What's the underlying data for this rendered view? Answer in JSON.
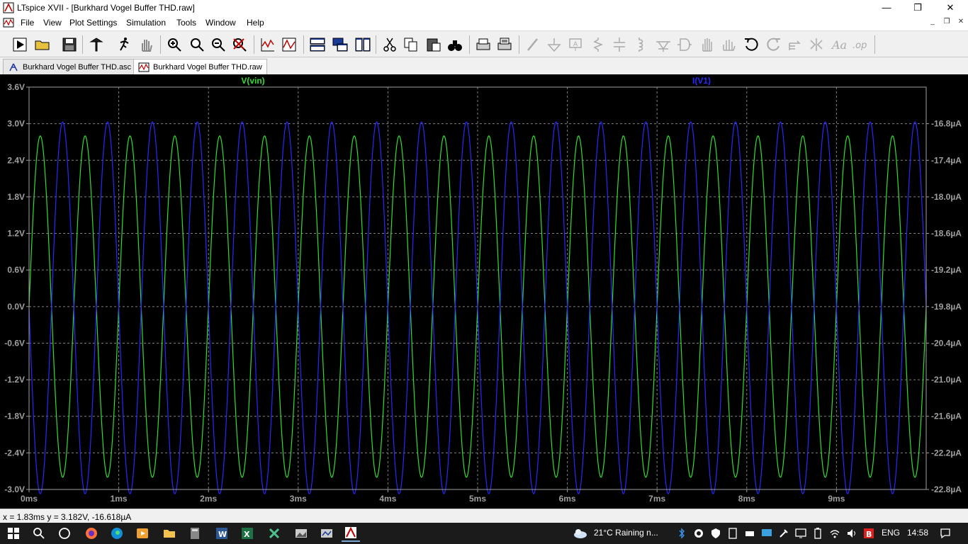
{
  "window": {
    "title": "LTspice XVII - [Burkhard Vogel Buffer THD.raw]",
    "minimize_glyph": "—",
    "maximize_glyph": "❐",
    "close_glyph": "✕"
  },
  "menu": {
    "items": [
      "File",
      "View",
      "Plot Settings",
      "Simulation",
      "Tools",
      "Window",
      "Help"
    ],
    "mdi_buttons": [
      "_",
      "❐",
      "✕"
    ]
  },
  "toolbar": {
    "icons": [
      "run-icon",
      "open-icon",
      "save-icon",
      "control-panel-icon",
      "run-man-icon",
      "halt-icon",
      "zoom-area-icon",
      "pan-zoom-icon",
      "zoom-out-icon",
      "zoom-fit-icon",
      "autorange-icon",
      "grid-icon",
      "tile-vertical-icon",
      "cascade-icon",
      "tile-horizontal-icon",
      "cut-icon",
      "copy-icon",
      "paste-icon",
      "find-icon",
      "print-icon",
      "print-setup-icon",
      "wire-icon",
      "ground-icon",
      "label-net-icon",
      "resistor-icon",
      "capacitor-icon",
      "inductor-icon",
      "diode-icon",
      "component-icon",
      "move-icon",
      "drag-icon",
      "undo-icon",
      "redo-icon",
      "rotate-icon",
      "mirror-icon",
      "text-icon",
      "spice-directive-icon"
    ]
  },
  "tabs": [
    {
      "label": "Burkhard Vogel Buffer THD.asc",
      "active": false
    },
    {
      "label": "Burkhard Vogel Buffer THD.raw",
      "active": true
    }
  ],
  "plot": {
    "background": "#000000",
    "grid_color": "#808080",
    "traces": [
      {
        "label": "V(vin)",
        "color": "#32dc32"
      },
      {
        "label": "I(V1)",
        "color": "#2828ff"
      }
    ]
  },
  "chart_data": {
    "type": "line",
    "xlabel": "",
    "ylabel": "",
    "x_ticks": [
      "0ms",
      "1ms",
      "2ms",
      "3ms",
      "4ms",
      "5ms",
      "6ms",
      "7ms",
      "8ms",
      "9ms"
    ],
    "x_range_ms": [
      0,
      10
    ],
    "y_left_ticks": [
      "3.6V",
      "3.0V",
      "2.4V",
      "1.8V",
      "1.2V",
      "0.6V",
      "0.0V",
      "-0.6V",
      "-1.2V",
      "-1.8V",
      "-2.4V",
      "-3.0V"
    ],
    "y_left_range": [
      -3.0,
      3.6
    ],
    "y_right_ticks": [
      "-16.8µA",
      "-17.4µA",
      "-18.0µA",
      "-18.6µA",
      "-19.2µA",
      "-19.8µA",
      "-20.4µA",
      "-21.0µA",
      "-21.6µA",
      "-22.2µA",
      "-22.8µA"
    ],
    "y_right_range": [
      -22.8,
      -16.2
    ],
    "grid": true,
    "series": [
      {
        "name": "V(vin)",
        "axis": "left",
        "waveform": "sine",
        "frequency_hz": 2000,
        "amplitude": 2.8,
        "offset": 0.0,
        "phase_deg": 0
      },
      {
        "name": "I(V1)",
        "axis": "right",
        "waveform": "sine",
        "frequency_hz": 2000,
        "amplitude": 3.05,
        "offset": -19.82,
        "phase_deg": 180
      }
    ]
  },
  "status": {
    "text": "x = 1.83ms    y = 3.182V, -16.618µA"
  },
  "taskbar": {
    "apps": [
      "file-explorer-icon",
      "calculator-icon",
      "word-icon",
      "excel-icon",
      "python-icon",
      "photo-icon",
      "network-icon",
      "ltspice-icon"
    ],
    "weather": "21°C  Raining n...",
    "language": "ENG",
    "time": "14:58"
  }
}
